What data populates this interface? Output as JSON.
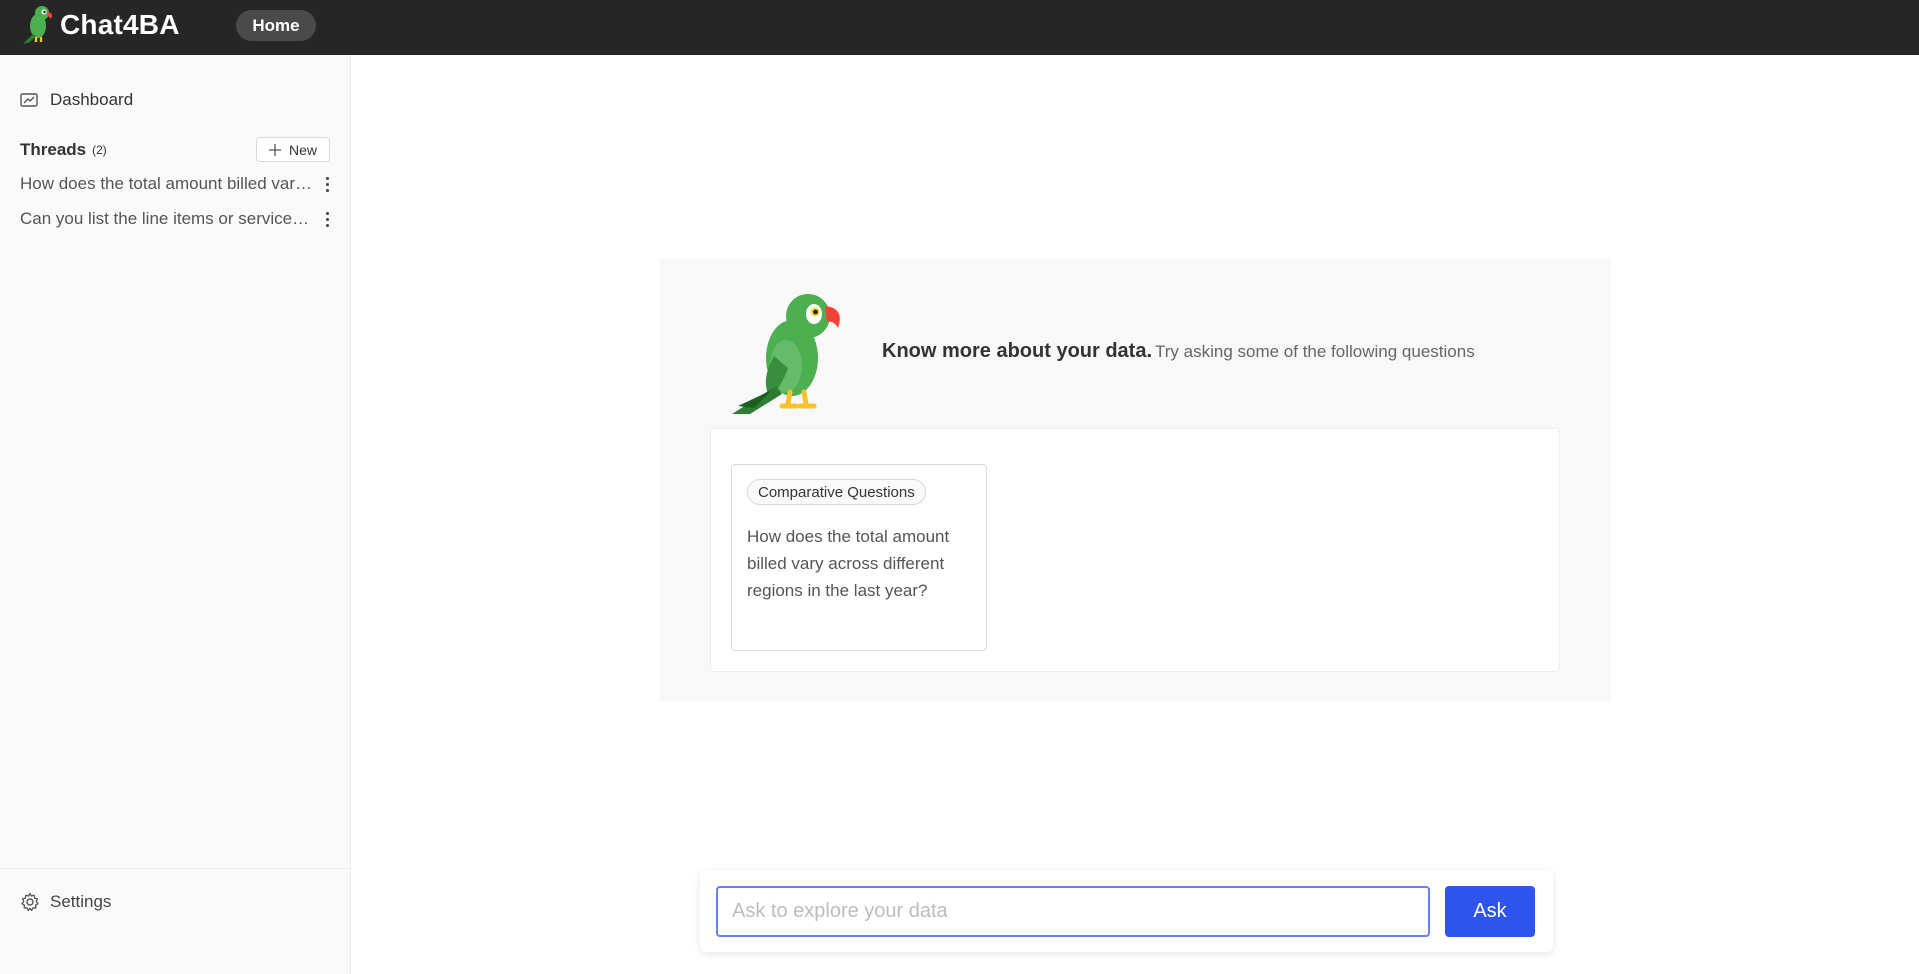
{
  "header": {
    "app_name": "Chat4BA",
    "home_label": "Home"
  },
  "sidebar": {
    "dashboard_label": "Dashboard",
    "threads_title": "Threads",
    "threads_count": "(2)",
    "new_label": "New",
    "threads": [
      "How does the total amount billed vary across different regions in the last year?",
      "Can you list the line items or services billed to a specific customer?"
    ],
    "settings_label": "Settings"
  },
  "main": {
    "title": "Know more about your data.",
    "subtitle": "Try asking some of the following questions",
    "questions": [
      {
        "tag": "Comparative Questions",
        "text": "How does the total amount billed vary across different regions in the last year?"
      }
    ]
  },
  "ask": {
    "placeholder": "Ask to explore your data",
    "button_label": "Ask"
  },
  "colors": {
    "topbar": "#262626",
    "accent": "#2f54eb",
    "parrot_green": "#4caf50",
    "beak": "#f44336"
  }
}
